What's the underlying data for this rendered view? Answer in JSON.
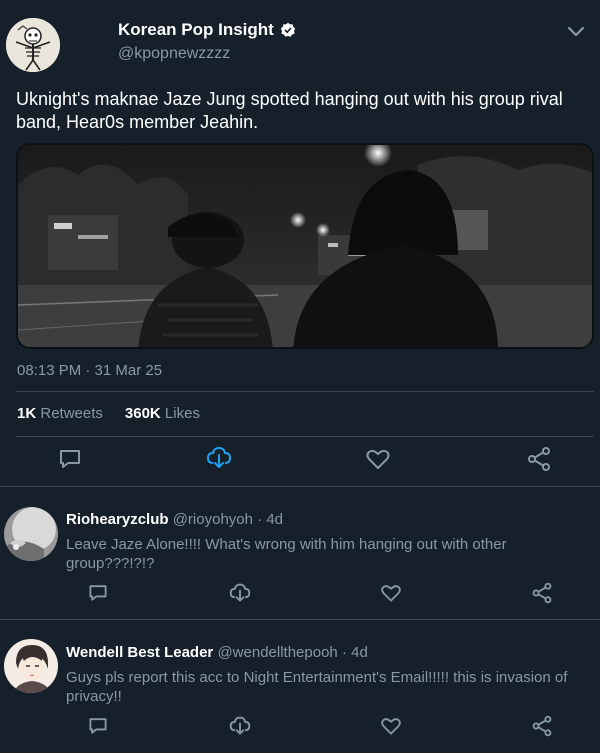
{
  "tweet": {
    "display_name": "Korean Pop Insight",
    "handle": "@kpopnewzzzz",
    "text": "Uknight's maknae Jaze Jung spotted hanging out with his group rival band, Hear0s member Jeahin.",
    "timestamp": "08:13 PM · 31 Mar 25",
    "retweets_count": "1K",
    "retweets_label": "Retweets",
    "likes_count": "360K",
    "likes_label": "Likes"
  },
  "replies": [
    {
      "name": "Riohearyzclub",
      "handle": "@rioyohyoh",
      "time": "· 4d",
      "text": "Leave Jaze Alone!!!! What's wrong with him hanging out with other group???!?!?"
    },
    {
      "name": "Wendell Best Leader",
      "handle": "@wendellthepooh",
      "time": "· 4d",
      "text": "Guys pls report this acc to Night Entertainment's Email!!!!! this is invasion of privacy!!"
    }
  ],
  "colors": {
    "background": "#15202b",
    "muted_text": "#8899a6",
    "accent": "#1da1f2",
    "divider": "#38444d"
  },
  "icons": [
    "chevron-down-icon",
    "verified-badge-icon",
    "reply-icon",
    "retweet-icon",
    "like-icon",
    "share-icon"
  ]
}
